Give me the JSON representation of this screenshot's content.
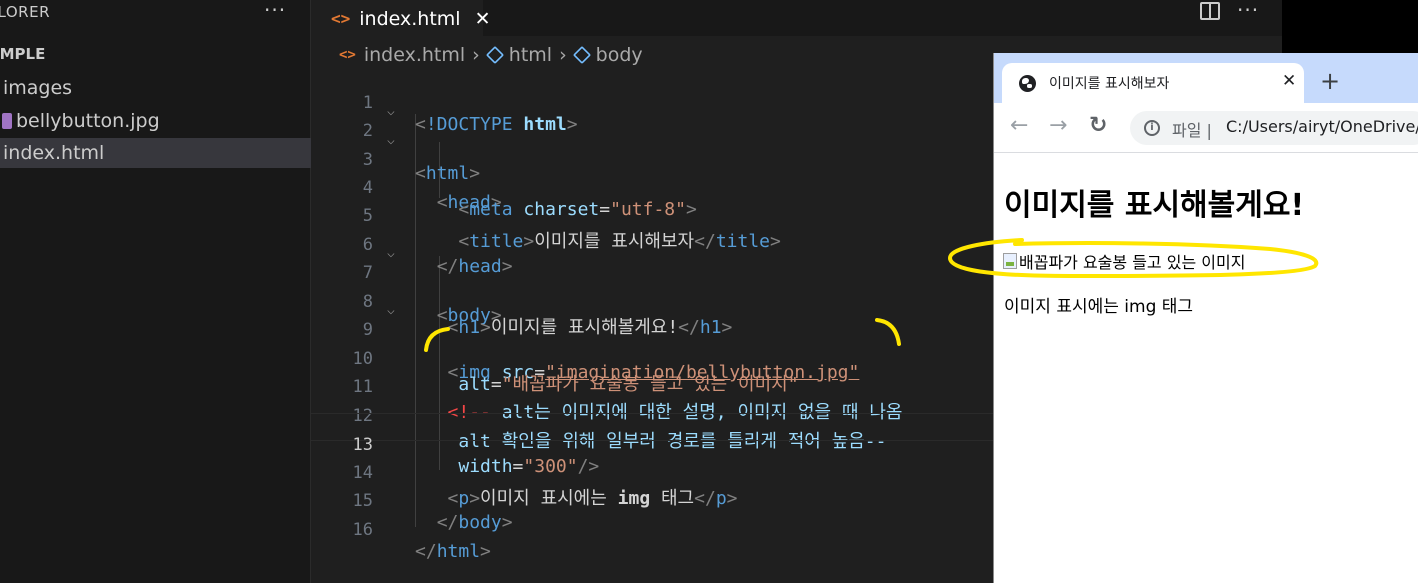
{
  "sidebar": {
    "title": "PLORER",
    "more_label": "···",
    "project": "AMPLE",
    "items": [
      {
        "label": "images"
      },
      {
        "label": "bellybutton.jpg"
      },
      {
        "label": "index.html"
      }
    ]
  },
  "editor": {
    "tab": {
      "icon": "<>",
      "label": "index.html",
      "close": "✕"
    },
    "more_label": "···",
    "breadcrumb": {
      "icon": "<>",
      "file": "index.html",
      "sep": "›",
      "crumb1": "html",
      "crumb2": "body"
    },
    "lines": [
      {
        "n": "1"
      },
      {
        "n": "2"
      },
      {
        "n": "3"
      },
      {
        "n": "4"
      },
      {
        "n": "5"
      },
      {
        "n": "6"
      },
      {
        "n": "7"
      },
      {
        "n": "8"
      },
      {
        "n": "9"
      },
      {
        "n": "10"
      },
      {
        "n": "11"
      },
      {
        "n": "12"
      },
      {
        "n": "13"
      },
      {
        "n": "14"
      },
      {
        "n": "15"
      },
      {
        "n": "16"
      }
    ],
    "code": {
      "doctype": "!DOCTYPE",
      "html": "html",
      "head": "head",
      "meta": "meta",
      "charset_attr": "charset",
      "charset_val": "\"utf-8\"",
      "title_tag": "title",
      "title_text": "이미지를 표시해보자",
      "body": "body",
      "h1": "h1",
      "h1_text": "이미지를 표시해볼게요!",
      "img": "img",
      "src_attr": "src",
      "src_val": "\"imagination/bellybutton.jpg\"",
      "alt_attr": "alt",
      "alt_val": "\"배꼽파가 요술봉 들고 있는 이미지\"",
      "comment_open": "<!--",
      "comment_alt": "alt",
      "comment_text1": "는 이미지에 대한 설명, 이미지 없을 때 나옴",
      "comment_line2_alt": "alt",
      "comment_text2": " 확인을 위해 일부러 경로를 틀리게 적어 높음--",
      "width_attr": "width",
      "width_val": "\"300\"",
      "p": "p",
      "p_text1": "이미지 표시에는 ",
      "p_text_img": "img",
      "p_text2": " 태그"
    }
  },
  "browser": {
    "tab_title": "이미지를 표시해보자",
    "tab_close": "✕",
    "new_tab": "+",
    "back": "←",
    "forward": "→",
    "reload": "↻",
    "info": "i",
    "omni_label": "파일 |",
    "url": "C:/Users/airyt/OneDrive/",
    "page": {
      "h1": "이미지를 표시해볼게요!",
      "img_alt": "배꼽파가 요술봉 들고 있는 이미지",
      "p": "이미지 표시에는 img 태그"
    }
  },
  "colors": {
    "annotation": "#ffe600",
    "tag": "#569cd6",
    "string": "#ce9178",
    "attribute": "#9cdcfe",
    "comment_error": "#f44747"
  }
}
